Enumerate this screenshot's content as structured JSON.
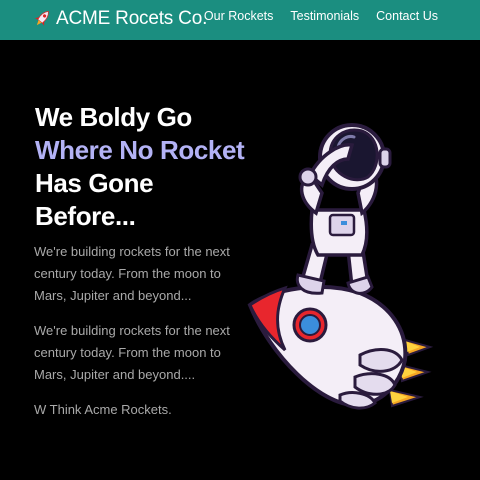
{
  "navbar": {
    "brand": "ACME Rocets Co.",
    "brand_icon": "rocket-icon",
    "links": [
      "Our Rockets",
      "Testimonials",
      "Contact Us"
    ],
    "background": "#1b8e80"
  },
  "hero": {
    "headline_line1": "We Boldy Go",
    "headline_accent": "Where No Rocket",
    "headline_line3": "Has Gone",
    "headline_line4": "Before...",
    "accent_color": "#b3b2f5",
    "paragraph1": "We're building rockets for the next century today. From the moon to Mars, Jupiter and beyond...",
    "paragraph2": "We're building rockets for the next century today. From the moon to Mars, Jupiter and beyond....",
    "paragraph3": "W Think Acme Rockets.",
    "illustration": "astronaut-on-rocket-illustration"
  }
}
